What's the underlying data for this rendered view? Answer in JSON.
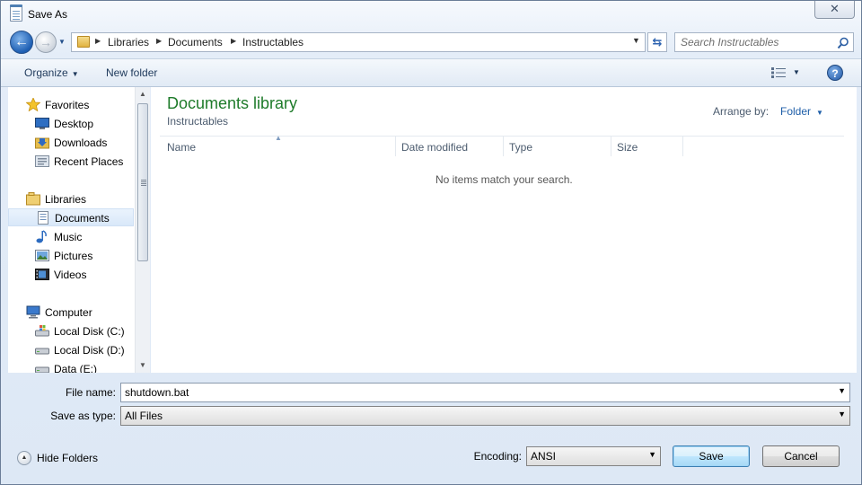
{
  "window": {
    "title": "Save As",
    "close_glyph": "✕"
  },
  "address": {
    "breadcrumbs": [
      "Libraries",
      "Documents",
      "Instructables"
    ],
    "search_placeholder": "Search Instructables"
  },
  "toolbar": {
    "organize": "Organize",
    "new_folder": "New folder",
    "help": "?"
  },
  "nav": {
    "favorites": {
      "label": "Favorites",
      "items": [
        "Desktop",
        "Downloads",
        "Recent Places"
      ]
    },
    "libraries": {
      "label": "Libraries",
      "items": [
        "Documents",
        "Music",
        "Pictures",
        "Videos"
      ],
      "selected": "Documents"
    },
    "computer": {
      "label": "Computer",
      "items": [
        "Local Disk (C:)",
        "Local Disk (D:)",
        "Data (E:)"
      ]
    }
  },
  "content": {
    "title": "Documents library",
    "subtitle": "Instructables",
    "arrange_label": "Arrange by:",
    "arrange_value": "Folder",
    "columns": [
      "Name",
      "Date modified",
      "Type",
      "Size"
    ],
    "empty_message": "No items match your search."
  },
  "form": {
    "file_name_label": "File name:",
    "file_name_value": "shutdown.bat",
    "save_type_label": "Save as type:",
    "save_type_value": "All Files",
    "encoding_label": "Encoding:",
    "encoding_value": "ANSI"
  },
  "footer": {
    "hide_folders": "Hide Folders",
    "save": "Save",
    "cancel": "Cancel"
  },
  "colors": {
    "library_title": "#1e7b2a",
    "link_blue": "#1e5ea8",
    "accent": "#3c7fb1"
  }
}
